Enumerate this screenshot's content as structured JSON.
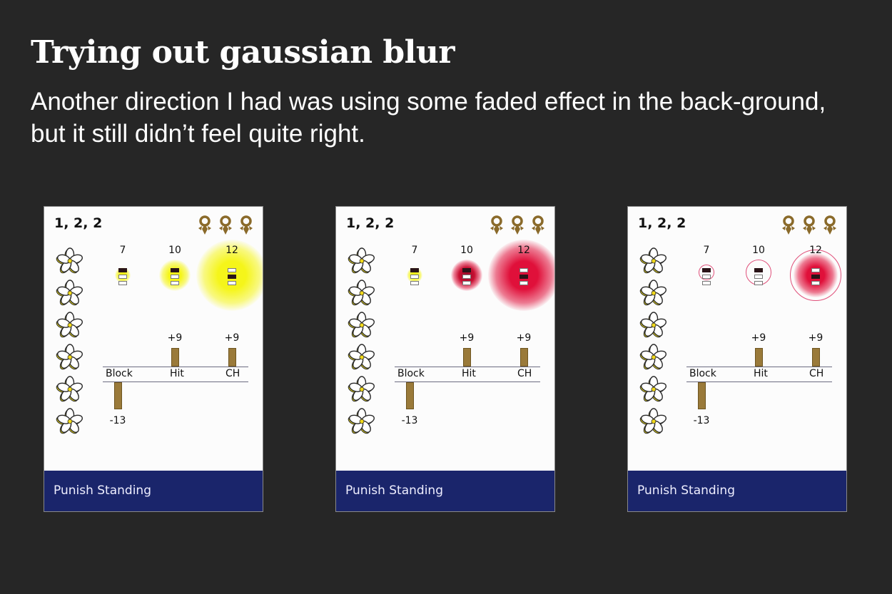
{
  "header": {
    "title": "Trying out gaussian blur",
    "subtitle": "Another direction I had was using some faded effect in the back-ground, but it still didn’t feel quite right."
  },
  "colors": {
    "background": "#262626",
    "card": "#fcfcfc",
    "footer": "#1a256b",
    "bar": "#9a7a3a",
    "yellow_glow": "#f5f51a",
    "red_glow": "#e0103a",
    "ring": "#e0507a"
  },
  "cards": [
    {
      "variant": "yellow-blur",
      "combo": "1, 2, 2",
      "medal_count": 3,
      "flower_count": 6,
      "frames": [
        {
          "label": "7",
          "active_pip": 0,
          "glow": "yellow",
          "glow_strength": "small"
        },
        {
          "label": "10",
          "active_pip": 0,
          "glow": "yellow",
          "glow_strength": "medium"
        },
        {
          "label": "12",
          "active_pip": 1,
          "glow": "yellow",
          "glow_strength": "large"
        }
      ],
      "advantage": [
        {
          "label": "Block",
          "value": -13,
          "display": "-13"
        },
        {
          "label": "Hit",
          "value": 9,
          "display": "+9"
        },
        {
          "label": "CH",
          "value": 9,
          "display": "+9"
        }
      ],
      "footer": "Punish Standing"
    },
    {
      "variant": "red-blur",
      "combo": "1, 2, 2",
      "medal_count": 3,
      "flower_count": 6,
      "frames": [
        {
          "label": "7",
          "active_pip": 0,
          "glow": "yellow",
          "glow_strength": "small"
        },
        {
          "label": "10",
          "active_pip": 0,
          "glow": "red",
          "glow_strength": "medium"
        },
        {
          "label": "12",
          "active_pip": 1,
          "glow": "red",
          "glow_strength": "large"
        }
      ],
      "advantage": [
        {
          "label": "Block",
          "value": -13,
          "display": "-13"
        },
        {
          "label": "Hit",
          "value": 9,
          "display": "+9"
        },
        {
          "label": "CH",
          "value": 9,
          "display": "+9"
        }
      ],
      "footer": "Punish Standing"
    },
    {
      "variant": "ring-outline",
      "combo": "1, 2, 2",
      "medal_count": 3,
      "flower_count": 6,
      "frames": [
        {
          "label": "7",
          "active_pip": 0,
          "glow": "ring",
          "glow_strength": "small"
        },
        {
          "label": "10",
          "active_pip": 0,
          "glow": "ring",
          "glow_strength": "medium"
        },
        {
          "label": "12",
          "active_pip": 1,
          "glow": "ring-red",
          "glow_strength": "large"
        }
      ],
      "advantage": [
        {
          "label": "Block",
          "value": -13,
          "display": "-13"
        },
        {
          "label": "Hit",
          "value": 9,
          "display": "+9"
        },
        {
          "label": "CH",
          "value": 9,
          "display": "+9"
        }
      ],
      "footer": "Punish Standing"
    }
  ]
}
